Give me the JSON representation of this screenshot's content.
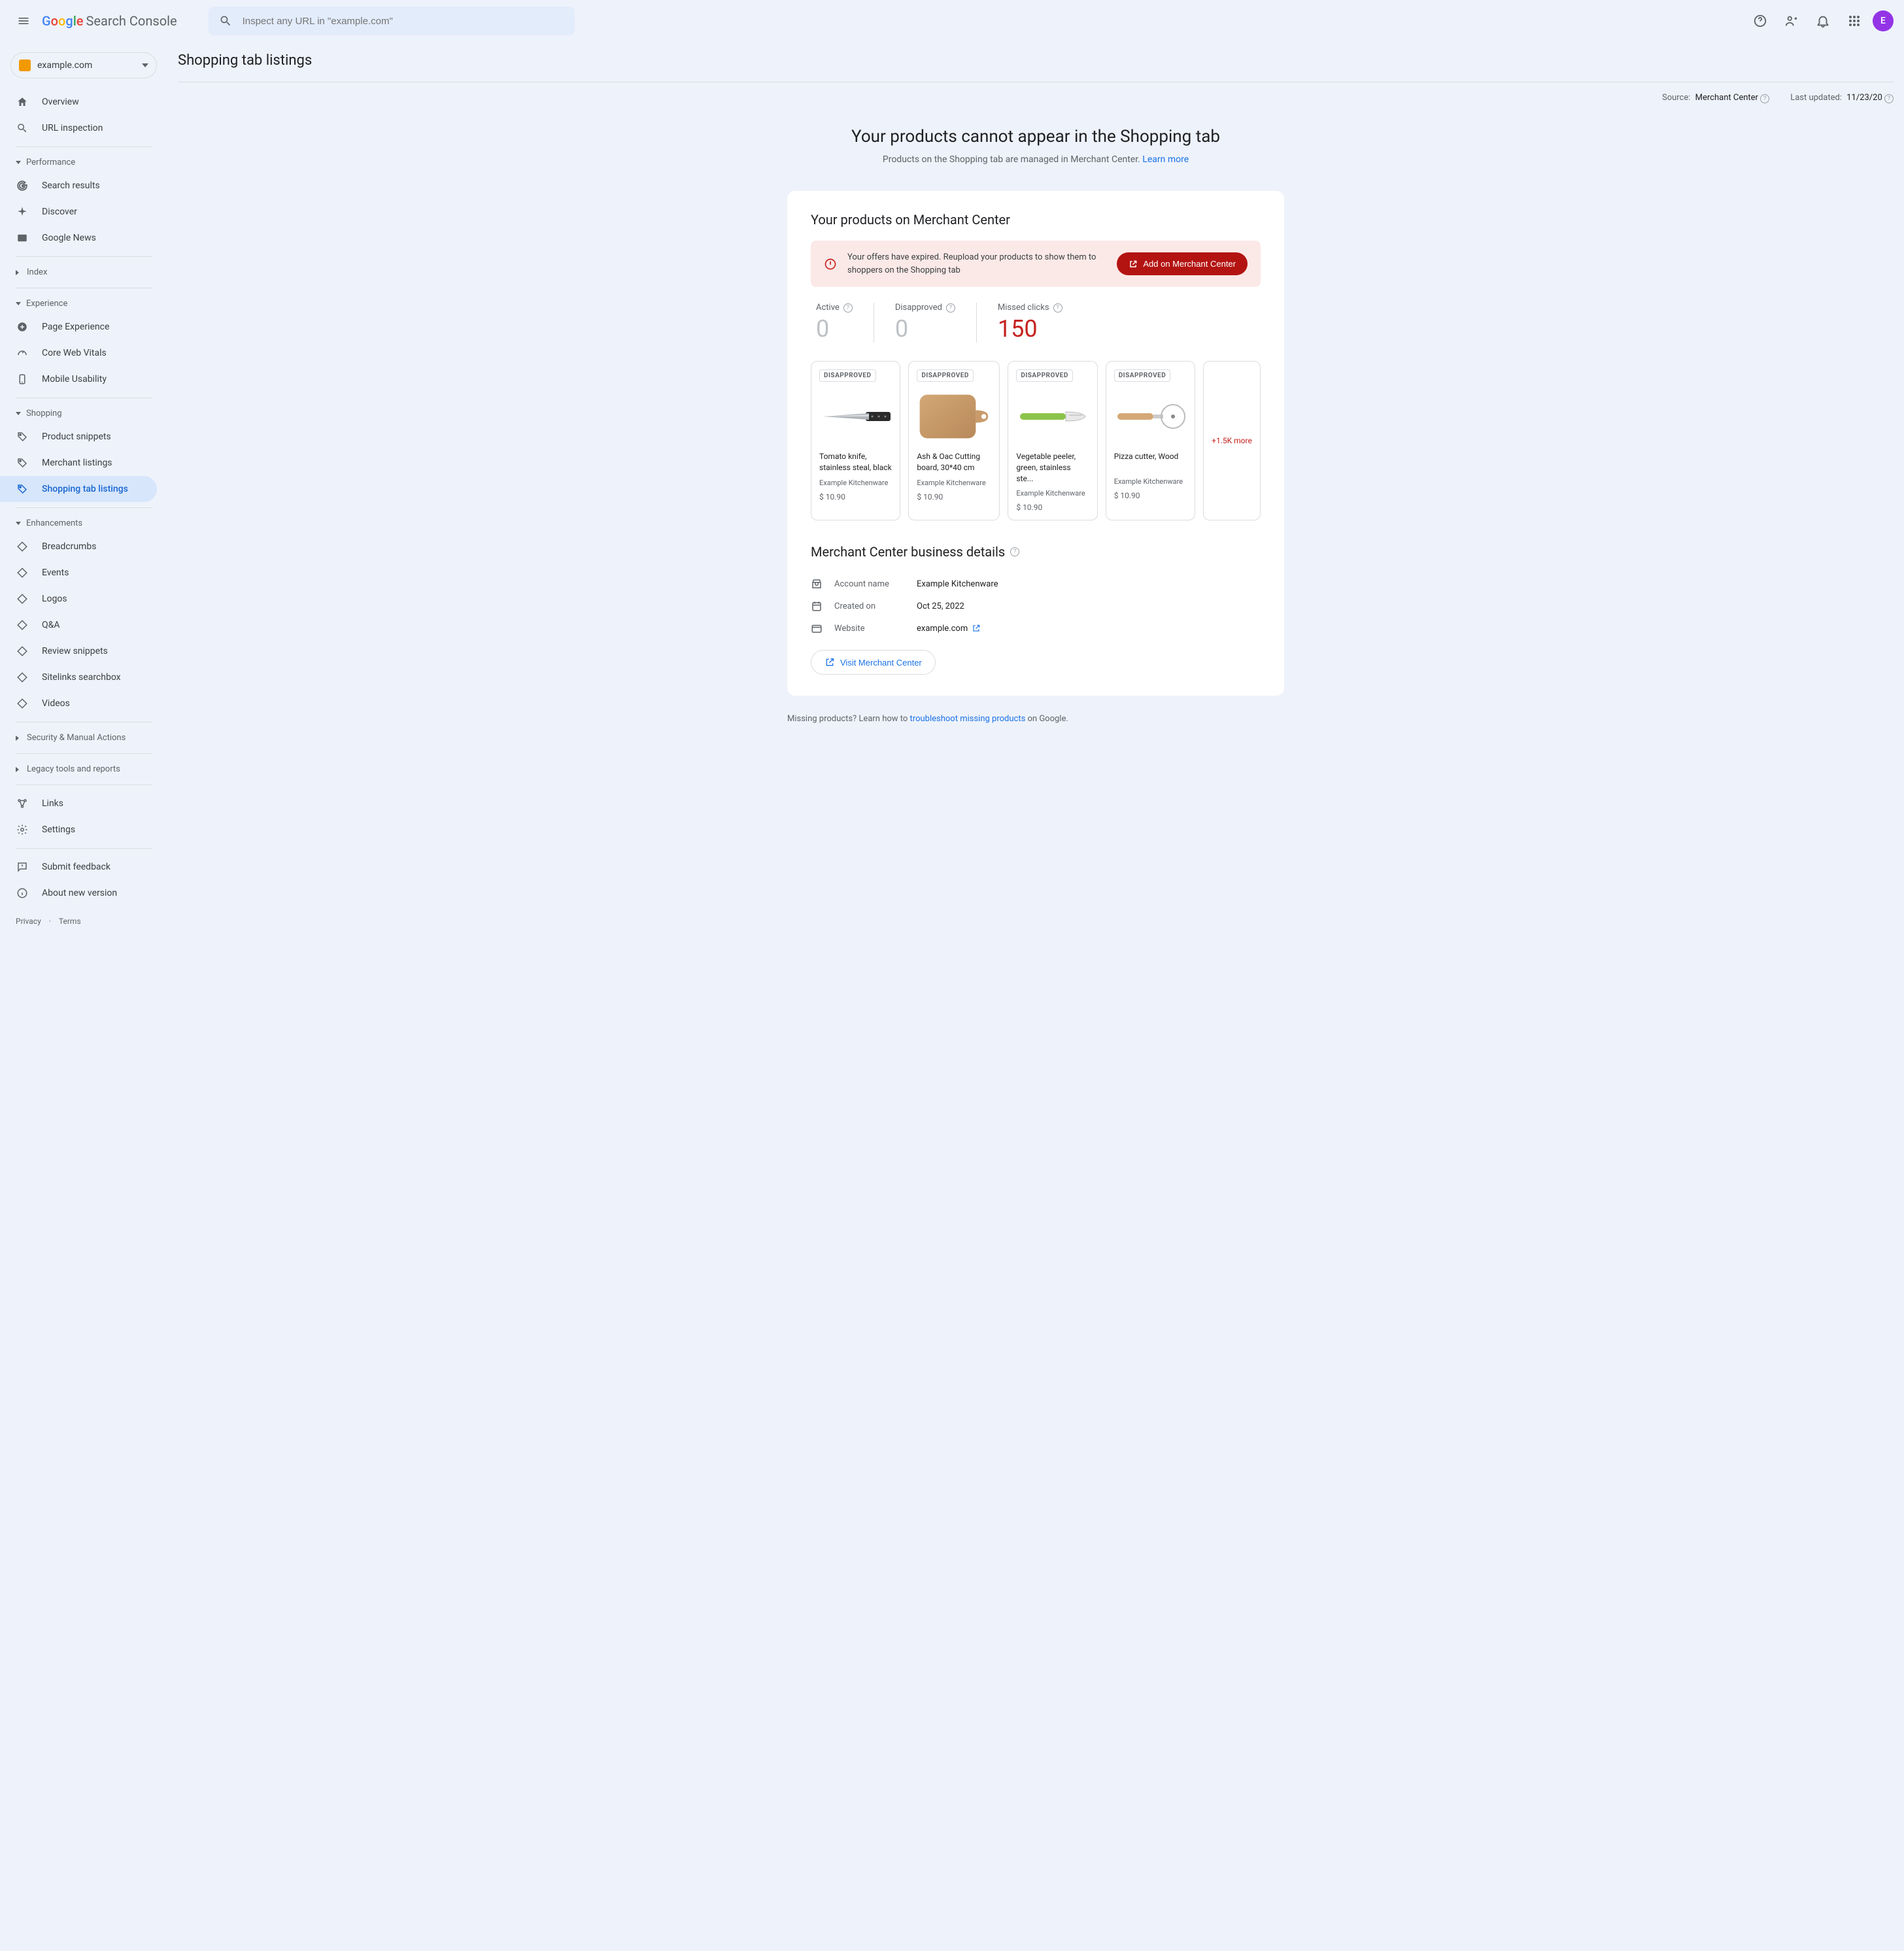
{
  "header": {
    "logo_text": "Search Console",
    "search_placeholder": "Inspect any URL in \"example.com\"",
    "avatar_letter": "E"
  },
  "property": {
    "name": "example.com"
  },
  "sidebar": {
    "overview": "Overview",
    "url_inspection": "URL inspection",
    "sections": {
      "performance": "Performance",
      "index": "Index",
      "experience": "Experience",
      "shopping": "Shopping",
      "enhancements": "Enhancements",
      "security": "Security & Manual Actions",
      "legacy": "Legacy tools and reports"
    },
    "perf": {
      "search_results": "Search results",
      "discover": "Discover",
      "google_news": "Google News"
    },
    "exp": {
      "page_experience": "Page Experience",
      "cwv": "Core Web Vitals",
      "mobile": "Mobile Usability"
    },
    "shop": {
      "snippets": "Product snippets",
      "merchant": "Merchant listings",
      "shopping_tab": "Shopping tab listings"
    },
    "enh": {
      "breadcrumbs": "Breadcrumbs",
      "events": "Events",
      "logos": "Logos",
      "qa": "Q&A",
      "review": "Review snippets",
      "sitelinks": "Sitelinks searchbox",
      "videos": "Videos"
    },
    "bottom": {
      "links": "Links",
      "settings": "Settings",
      "feedback": "Submit feedback",
      "about": "About new version"
    },
    "footer": {
      "privacy": "Privacy",
      "terms": "Terms"
    }
  },
  "page": {
    "title": "Shopping tab listings",
    "source_label": "Source:",
    "source_value": "Merchant Center",
    "updated_label": "Last updated:",
    "updated_value": "11/23/20",
    "hero_title": "Your products cannot appear in the Shopping tab",
    "hero_sub": "Products on the Shopping tab are managed in Merchant Center. ",
    "learn_more": "Learn more"
  },
  "card": {
    "title": "Your products on Merchant Center",
    "alert_text": "Your offers have expired. Reupload your products to show them to shoppers on the Shopping tab",
    "alert_btn": "Add on Merchant Center",
    "stats": {
      "active_label": "Active",
      "active_val": "0",
      "disapproved_label": "Disapproved",
      "disapproved_val": "0",
      "missed_label": "Missed clicks",
      "missed_val": "150"
    },
    "badge": "DISAPPROVED",
    "products": [
      {
        "name": "Tomato knife, stainless steal, black",
        "store": "Example Kitchenware",
        "price": "$ 10.90"
      },
      {
        "name": "Ash & Oac Cutting board, 30*40 cm",
        "store": "Example Kitchenware",
        "price": "$ 10.90"
      },
      {
        "name": "Vegetable peeler, green, stainless ste...",
        "store": "Example Kitchenware",
        "price": "$ 10.90"
      },
      {
        "name": "Pizza cutter, Wood",
        "store": "Example Kitchenware",
        "price": "$ 10.90"
      }
    ],
    "more": "+1.5K more"
  },
  "biz": {
    "title": "Merchant Center business details",
    "account_label": "Account name",
    "account_val": "Example Kitchenware",
    "created_label": "Created on",
    "created_val": "Oct 25, 2022",
    "website_label": "Website",
    "website_val": "example.com",
    "visit_btn": "Visit Merchant Center"
  },
  "footer_note": {
    "pre": "Missing products? Learn how to ",
    "link": "troubleshoot missing products",
    "post": " on Google."
  }
}
